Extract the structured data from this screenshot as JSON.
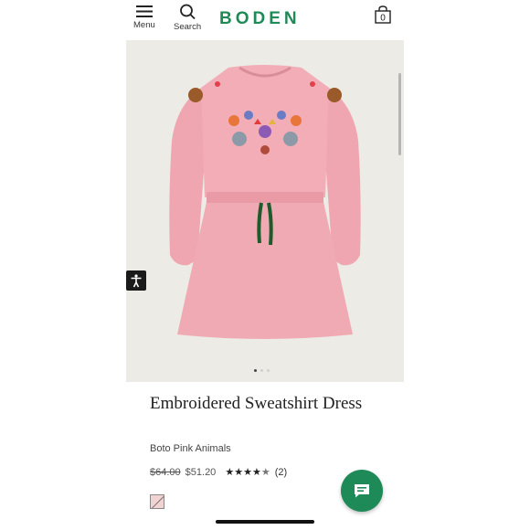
{
  "header": {
    "menu_label": "Menu",
    "search_label": "Search",
    "logo": "BODEN",
    "bag_count": "0"
  },
  "carousel": {
    "slide_count": 3,
    "active_slide": 1
  },
  "product": {
    "title": "Embroidered Sweatshirt Dress",
    "color_name": "Boto Pink Animals",
    "original_price": "$64.00",
    "sale_price": "$51.20",
    "rating_stars": "★★★★★",
    "rating_value": 4.5,
    "review_count": "(2)"
  },
  "colors": {
    "brand": "#1e8a55",
    "chat_button": "#1d8a58",
    "dress_pink": "#f0aab2",
    "drawstring": "#1f5a2a"
  },
  "icons": {
    "menu": "hamburger-icon",
    "search": "search-icon",
    "bag": "bag-icon",
    "accessibility": "accessibility-icon",
    "chat": "chat-icon",
    "swatch": "color-swatch"
  }
}
